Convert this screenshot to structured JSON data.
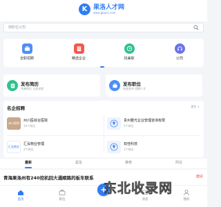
{
  "header": {
    "logo_mark": "K",
    "logo_name": "果洛人才网",
    "logo_url": "www.glzprc.com"
  },
  "search": {
    "placeholder": "搜职位公司"
  },
  "quick_links": [
    {
      "label": "全职招聘",
      "icon": "briefcase-icon",
      "color": "#4d8ff5"
    },
    {
      "label": "精选企业",
      "icon": "building-icon",
      "color": "#f5584b"
    },
    {
      "label": "找兼职",
      "icon": "clock-icon",
      "color": "#2fc28e"
    },
    {
      "label": "公司",
      "icon": "headset-icon",
      "color": "#6b74e8"
    }
  ],
  "publish": [
    {
      "title": "发布简历",
      "sub": "完善简历 立即求职",
      "icon": "resume-icon",
      "color": "#2fc28e"
    },
    {
      "title": "发布职位",
      "sub": "快速发布 招聘人才",
      "icon": "post-job-icon",
      "color": "#4d8ff5"
    }
  ],
  "companies": {
    "title": "名企招聘",
    "more": "更多 >",
    "items": [
      {
        "name": "州川医综合医院",
        "jobs": "10个岗位",
        "logo_text": "州川医院"
      },
      {
        "name": "贵州雅光企业管理咨询有限",
        "jobs": "1个岗位",
        "logo_text": ""
      },
      {
        "name": "汇泓物业管理",
        "jobs": "3个岗位",
        "logo_text": "汇泓物业"
      },
      {
        "name": "双佳科技",
        "jobs": "1个岗位",
        "logo_text": ""
      }
    ]
  },
  "tabs": [
    "最新",
    "紧急",
    "推荐",
    "附近"
  ],
  "news": {
    "title": "青海果洛州有240挖机回大通顺路的板车联系",
    "tag": "面议"
  },
  "bottom_nav": [
    "首页",
    "职位",
    "",
    "消息",
    "我的"
  ],
  "watermark": "东北收录网"
}
